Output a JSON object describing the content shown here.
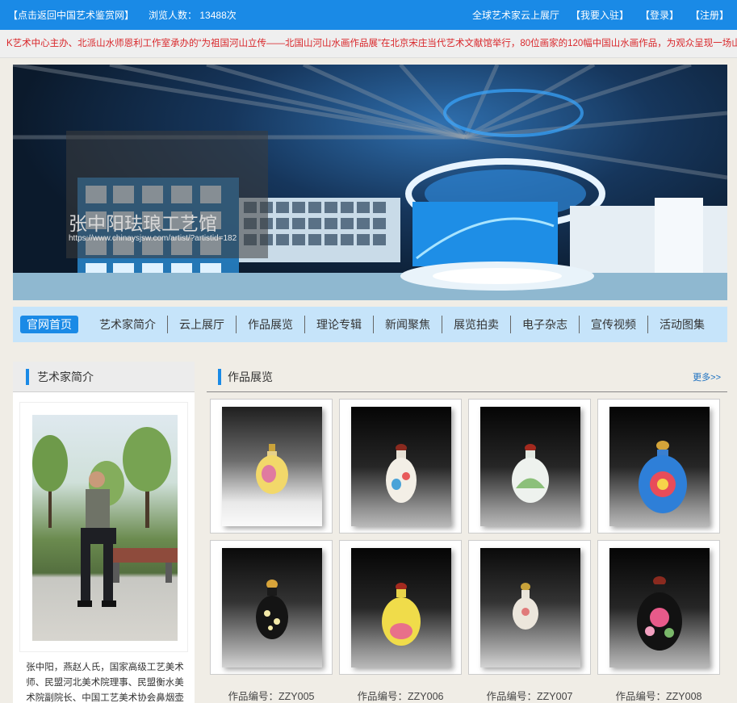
{
  "topbar": {
    "back_link": "【点击返回中国艺术鉴赏网】",
    "visits_label": "浏览人数：",
    "visits_count": "13488次",
    "cloud_hall_link": "全球艺术家云上展厅",
    "join_link": "【我要入驻】",
    "login_link": "【登录】",
    "register_link": "【注册】"
  },
  "marquee": {
    "text": "K艺术中心主办、北派山水师恩利工作室承办的“为祖国河山立传——北国山河山水画作品展”在北京宋庄当代艺术文献馆举行，80位画家的120幅中国山水画作品，为观众呈现一场山水画的视觉"
  },
  "banner": {
    "title": "张中阳珐琅工艺馆",
    "url": "https://www.chinaysjsw.com/artist/?artistid=182"
  },
  "nav": {
    "items": [
      "官网首页",
      "艺术家简介",
      "云上展厅",
      "作品展览",
      "理论专辑",
      "新闻聚焦",
      "展览拍卖",
      "电子杂志",
      "宣传视频",
      "活动图集"
    ]
  },
  "artist_panel": {
    "heading": "艺术家简介",
    "bio": "张中阳，燕赵人氏，国家高级工艺美术师、民盟河北美术院理事、民盟衡水美术院副院长、中国工艺美术协会鼻烟壶委员会会员、"
  },
  "works_panel": {
    "heading": "作品展览",
    "more_link": "更多>>",
    "captions": [
      "作品编号：ZZY005",
      "作品编号：ZZY006",
      "作品编号：ZZY007",
      "作品编号：ZZY008"
    ]
  },
  "colors": {
    "brand_blue": "#1a8ae6",
    "nav_bg": "#c6e4fa",
    "marquee_red": "#d9272b"
  }
}
